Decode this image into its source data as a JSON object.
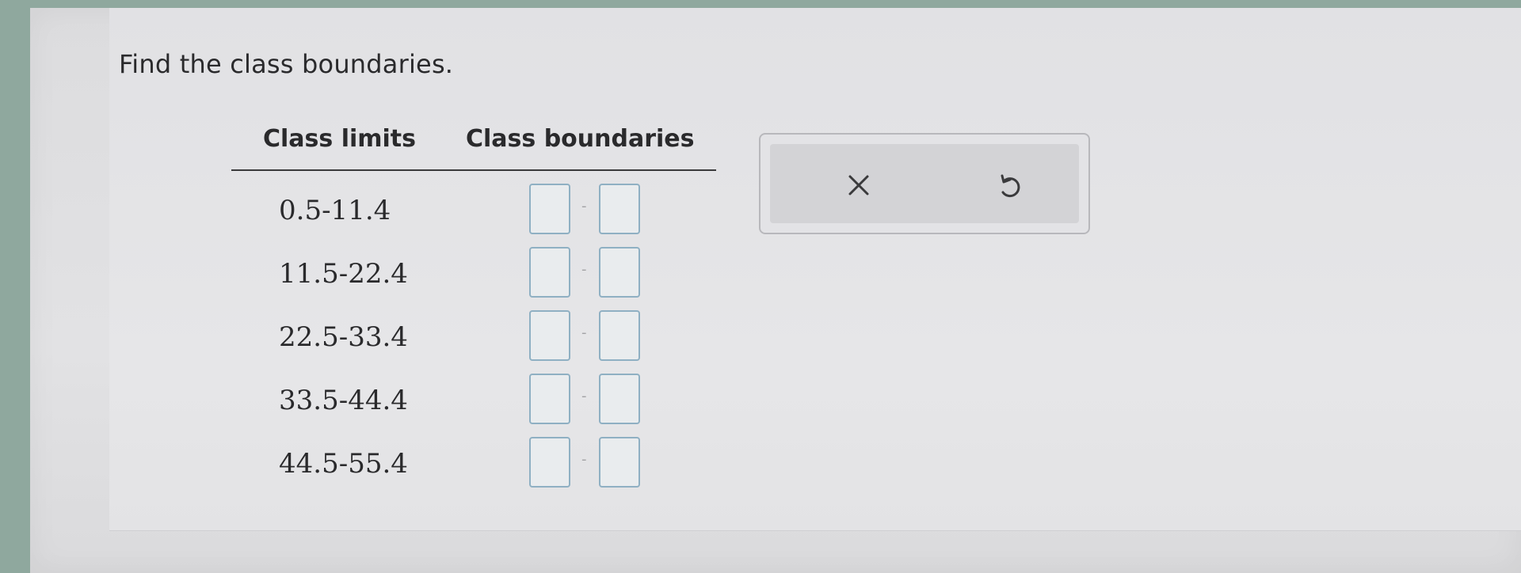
{
  "question": {
    "prompt": "Find the class boundaries."
  },
  "table": {
    "headers": {
      "limits": "Class limits",
      "boundaries": "Class boundaries"
    },
    "rows": [
      {
        "limits": "0.5-11.4",
        "lower_value": "",
        "upper_value": ""
      },
      {
        "limits": "11.5-22.4",
        "lower_value": "",
        "upper_value": ""
      },
      {
        "limits": "22.5-33.4",
        "lower_value": "",
        "upper_value": ""
      },
      {
        "limits": "33.5-44.4",
        "lower_value": "",
        "upper_value": ""
      },
      {
        "limits": "44.5-55.4",
        "lower_value": "",
        "upper_value": ""
      }
    ],
    "separator": "-"
  },
  "actions": {
    "clear_icon": "x-icon",
    "undo_icon": "undo-icon"
  },
  "colors": {
    "input_border": "#8fb0c3",
    "text": "#2a2a2c"
  }
}
